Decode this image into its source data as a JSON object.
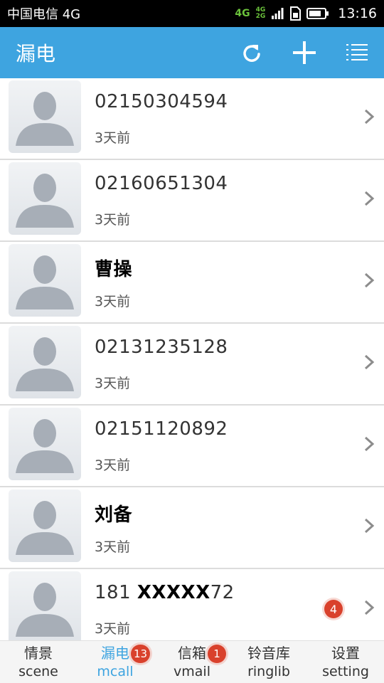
{
  "status_bar": {
    "carrier": "中国电信 4G",
    "net_primary": "4G",
    "net_top": "4G",
    "net_bottom": "2G",
    "time": "13:16"
  },
  "header": {
    "title": "漏电",
    "icons": [
      "refresh-icon",
      "plus-icon",
      "menu-list-icon"
    ]
  },
  "calls": [
    {
      "name": "02150304594",
      "time": "3天前",
      "bold": false
    },
    {
      "name": "02160651304",
      "time": "3天前",
      "bold": false
    },
    {
      "name": "曹操",
      "time": "3天前",
      "bold": true
    },
    {
      "name": "02131235128",
      "time": "3天前",
      "bold": false
    },
    {
      "name": "02151120892",
      "time": "3天前",
      "bold": false
    },
    {
      "name": "刘备",
      "time": "3天前",
      "bold": true
    },
    {
      "name_prefix": "181 ",
      "name_mask": "XXXXX",
      "name_suffix": "72",
      "time": "3天前",
      "badge": "4"
    }
  ],
  "tabs": [
    {
      "cn": "情景",
      "en": "scene"
    },
    {
      "cn": "漏电",
      "en": "mcall",
      "badge": "13",
      "active": true
    },
    {
      "cn": "信箱",
      "en": "vmail",
      "badge": "1"
    },
    {
      "cn": "铃音库",
      "en": "ringlib"
    },
    {
      "cn": "设置",
      "en": "setting"
    }
  ],
  "colors": {
    "accent": "#3ea4e0",
    "badge": "#d9412c",
    "status_bar": "#000000"
  }
}
